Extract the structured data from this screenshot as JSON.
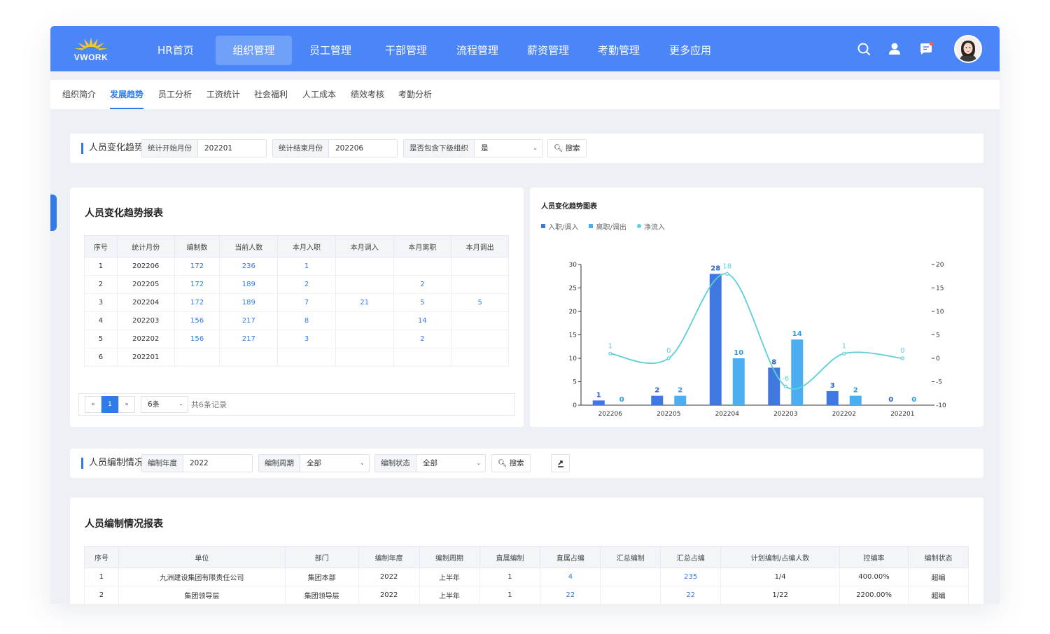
{
  "brand": {
    "logo_text": "VWORK"
  },
  "nav": {
    "items": [
      {
        "label": "HR首页"
      },
      {
        "label": "组织管理"
      },
      {
        "label": "员工管理"
      },
      {
        "label": "干部管理"
      },
      {
        "label": "流程管理"
      },
      {
        "label": "薪资管理"
      },
      {
        "label": "考勤管理"
      },
      {
        "label": "更多应用"
      }
    ],
    "active_index": 1
  },
  "subnav": {
    "items": [
      {
        "label": "组织简介"
      },
      {
        "label": "发展趋势"
      },
      {
        "label": "员工分析"
      },
      {
        "label": "工资统计"
      },
      {
        "label": "社会福利"
      },
      {
        "label": "人工成本"
      },
      {
        "label": "绩效考核"
      },
      {
        "label": "考勤分析"
      }
    ],
    "active_index": 1
  },
  "trend_filter": {
    "title": "人员变化趋势",
    "start_label": "统计开始月份",
    "start_value": "202201",
    "end_label": "统计结束月份",
    "end_value": "202206",
    "include_label": "是否包含下级组织",
    "include_value": "是",
    "search_label": "搜索"
  },
  "trend_report": {
    "title": "人员变化趋势报表",
    "columns": [
      "序号",
      "统计月份",
      "编制数",
      "当前人数",
      "本月入职",
      "本月调入",
      "本月离职",
      "本月调出"
    ],
    "rows": [
      [
        "1",
        "202206",
        "172",
        "236",
        "1",
        "",
        "",
        ""
      ],
      [
        "2",
        "202205",
        "172",
        "189",
        "2",
        "",
        "2",
        ""
      ],
      [
        "3",
        "202204",
        "172",
        "189",
        "7",
        "21",
        "5",
        "5"
      ],
      [
        "4",
        "202203",
        "156",
        "217",
        "8",
        "",
        "14",
        ""
      ],
      [
        "5",
        "202202",
        "156",
        "217",
        "3",
        "",
        "2",
        ""
      ],
      [
        "6",
        "202201",
        "",
        "",
        "",
        "",
        "",
        ""
      ]
    ],
    "pager": {
      "prev": "«",
      "page": "1",
      "next": "»",
      "page_size": "6条",
      "total": "共6条记录"
    }
  },
  "chart_data": {
    "type": "bar",
    "title": "人员变化趋势图表",
    "categories": [
      "202206",
      "202205",
      "202204",
      "202203",
      "202202",
      "202201"
    ],
    "series": [
      {
        "name": "入职/调入",
        "type": "bar",
        "color": "#3f78e0",
        "values": [
          1,
          2,
          28,
          8,
          3,
          0
        ]
      },
      {
        "name": "离职/调出",
        "type": "bar",
        "color": "#4aaef0",
        "values": [
          0,
          2,
          10,
          14,
          2,
          0
        ]
      },
      {
        "name": "净流入",
        "type": "line",
        "color": "#5ccfd9",
        "axis": "right",
        "values": [
          1,
          0,
          18,
          -6,
          1,
          0
        ]
      }
    ],
    "ylim": [
      0,
      30
    ],
    "yticks": [
      0,
      5,
      10,
      15,
      20,
      25,
      30
    ],
    "y2lim": [
      -10,
      20
    ],
    "y2ticks": [
      -10,
      -5,
      0,
      5,
      10,
      15,
      20
    ],
    "legend_position": "top-left"
  },
  "staffing_filter": {
    "title": "人员编制情况",
    "year_label": "编制年度",
    "year_value": "2022",
    "period_label": "编制周期",
    "period_value": "全部",
    "status_label": "编制状态",
    "status_value": "全部",
    "search_label": "搜索"
  },
  "staffing_report": {
    "title": "人员编制情况报表",
    "columns": [
      "序号",
      "单位",
      "部门",
      "编制年度",
      "编制周期",
      "直属编制",
      "直属占编",
      "汇总编制",
      "汇总占编",
      "计划编制/占编人数",
      "控编率",
      "编制状态"
    ],
    "rows": [
      [
        "1",
        "九洲建设集团有限责任公司",
        "集团本部",
        "2022",
        "上半年",
        "1",
        "4",
        "",
        "235",
        "1/4",
        "400.00%",
        "超编"
      ],
      [
        "2",
        "集团领导层",
        "集团领导层",
        "2022",
        "上半年",
        "1",
        "22",
        "",
        "22",
        "1/22",
        "2200.00%",
        "超编"
      ]
    ]
  }
}
